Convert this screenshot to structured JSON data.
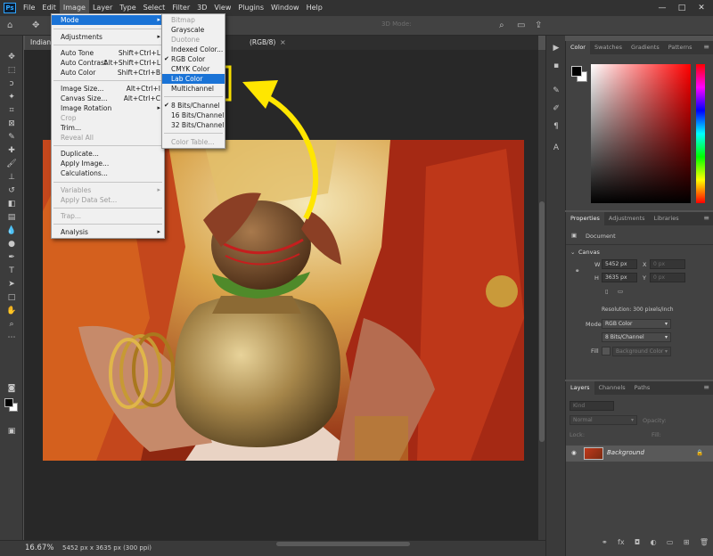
{
  "menubar": {
    "logo": "Ps",
    "items": [
      "File",
      "Edit",
      "Image",
      "Layer",
      "Type",
      "Select",
      "Filter",
      "3D",
      "View",
      "Plugins",
      "Window",
      "Help"
    ],
    "window_controls": [
      "—",
      "□",
      "✕"
    ]
  },
  "options_bar": {
    "mode_label": "3D Mode:"
  },
  "document_tab": {
    "left_text": "Indian-",
    "right_text": "(RGB/8)",
    "close": "×"
  },
  "image_menu": {
    "items": [
      {
        "label": "Mode",
        "arrow": "▸"
      },
      {
        "label": "Adjustments",
        "arrow": "▸"
      },
      {
        "label": "Auto Tone",
        "shortcut": "Shift+Ctrl+L"
      },
      {
        "label": "Auto Contrast",
        "shortcut": "Alt+Shift+Ctrl+L"
      },
      {
        "label": "Auto Color",
        "shortcut": "Shift+Ctrl+B"
      },
      {
        "label": "Image Size...",
        "shortcut": "Alt+Ctrl+I"
      },
      {
        "label": "Canvas Size...",
        "shortcut": "Alt+Ctrl+C"
      },
      {
        "label": "Image Rotation",
        "arrow": "▸"
      },
      {
        "label": "Crop"
      },
      {
        "label": "Trim..."
      },
      {
        "label": "Reveal All"
      },
      {
        "label": "Duplicate..."
      },
      {
        "label": "Apply Image..."
      },
      {
        "label": "Calculations..."
      },
      {
        "label": "Variables",
        "arrow": "▸"
      },
      {
        "label": "Apply Data Set..."
      },
      {
        "label": "Trap..."
      },
      {
        "label": "Analysis",
        "arrow": "▸"
      }
    ]
  },
  "mode_menu": {
    "items": [
      {
        "label": "Bitmap"
      },
      {
        "label": "Grayscale"
      },
      {
        "label": "Duotone"
      },
      {
        "label": "Indexed Color..."
      },
      {
        "label": "RGB Color",
        "check": "✔"
      },
      {
        "label": "CMYK Color"
      },
      {
        "label": "Lab Color"
      },
      {
        "label": "Multichannel"
      },
      {
        "label": "8 Bits/Channel",
        "check": "✔"
      },
      {
        "label": "16 Bits/Channel"
      },
      {
        "label": "32 Bits/Channel"
      },
      {
        "label": "Color Table..."
      }
    ]
  },
  "status": {
    "zoom": "16.67%",
    "doc_info": "5452 px x 3635 px (300 ppi)"
  },
  "color_panel": {
    "tabs": [
      "Color",
      "Swatches",
      "Gradients",
      "Patterns"
    ]
  },
  "properties_panel": {
    "tabs": [
      "Properties",
      "Adjustments",
      "Libraries"
    ],
    "document_label": "Document",
    "canvas_header": "Canvas",
    "w_label": "W",
    "w_value": "5452 px",
    "x_label": "X",
    "x_value": "0 px",
    "h_label": "H",
    "h_value": "3635 px",
    "y_label": "Y",
    "y_value": "0 px",
    "resolution": "Resolution: 300 pixels/inch",
    "mode_label": "Mode",
    "mode_value": "RGB Color",
    "bits_value": "8 Bits/Channel",
    "fill_label": "Fill",
    "fill_value": "Background Color"
  },
  "layers_panel": {
    "tabs": [
      "Layers",
      "Channels",
      "Paths"
    ],
    "kind_placeholder": "Kind",
    "blend_mode": "Normal",
    "opacity_label": "Opacity:",
    "lock_label": "Lock:",
    "fill_label": "Fill:",
    "layer_name": "Background"
  },
  "colors": {
    "highlight": "#1a73d6",
    "annotation_yellow": "#ffe600"
  }
}
